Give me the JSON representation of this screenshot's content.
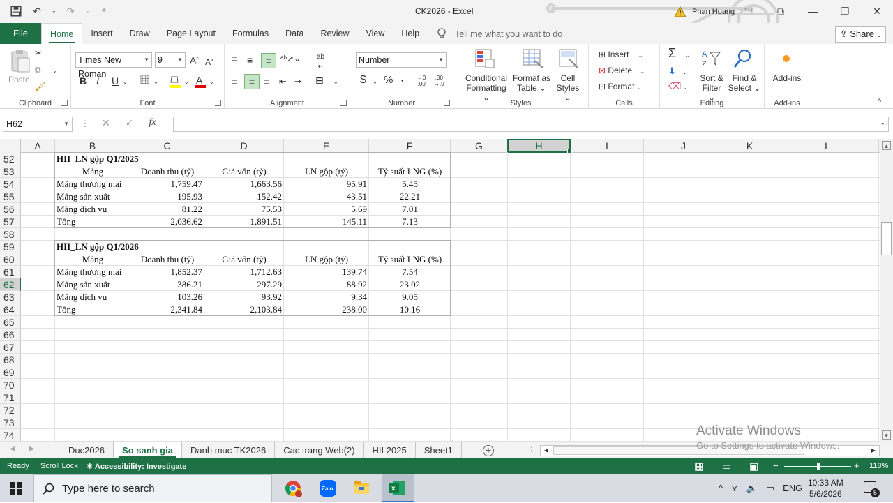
{
  "window": {
    "title": "CK2026  -  Excel",
    "user_name": "Phan Hoang",
    "user_initials": "PH"
  },
  "menu": {
    "file": "File",
    "tabs": [
      "Home",
      "Insert",
      "Draw",
      "Page Layout",
      "Formulas",
      "Data",
      "Review",
      "View",
      "Help"
    ],
    "active_tab": "Home",
    "tell_me": "Tell me what you want to do",
    "share": "Share"
  },
  "ribbon": {
    "clipboard": {
      "paste": "Paste",
      "label": "Clipboard"
    },
    "font": {
      "family": "Times New Roman",
      "size": "9",
      "label": "Font",
      "bold": "B",
      "italic": "I",
      "underline": "U"
    },
    "alignment": {
      "label": "Alignment"
    },
    "number": {
      "format": "Number",
      "label": "Number",
      "currency": "$",
      "percent": "%",
      "comma": ","
    },
    "styles": {
      "conditional": "Conditional",
      "conditional2": "Formatting",
      "format_as": "Format as",
      "format_as2": "Table",
      "cell": "Cell",
      "cell2": "Styles",
      "label": "Styles"
    },
    "cells": {
      "insert": "Insert",
      "delete": "Delete",
      "format": "Format",
      "label": "Cells"
    },
    "editing": {
      "sort": "Sort &",
      "sort2": "Filter",
      "find": "Find &",
      "find2": "Select",
      "label": "Editing"
    },
    "addins": {
      "addins": "Add-ins",
      "label": "Add-ins"
    }
  },
  "formula_bar": {
    "name_box": "H62",
    "fx": "fx",
    "value": ""
  },
  "columns": [
    "A",
    "B",
    "C",
    "D",
    "E",
    "F",
    "G",
    "H",
    "I",
    "J",
    "K",
    "L"
  ],
  "selected_column": "H",
  "rows": [
    "52",
    "53",
    "54",
    "55",
    "56",
    "57",
    "58",
    "59",
    "60",
    "61",
    "62",
    "63",
    "64",
    "65",
    "66",
    "67",
    "68",
    "69",
    "70",
    "71",
    "72",
    "73",
    "74"
  ],
  "selected_row": "62",
  "table1": {
    "title": "HII_LN gộp Q1/2025",
    "headers": [
      "Mảng",
      "Doanh thu (tỷ)",
      "Giá vốn (tỷ)",
      "LN gộp (tỷ)",
      "Tỷ suất LNG (%)"
    ],
    "rows": [
      [
        "Mảng thương mại",
        "1,759.47",
        "1,663.56",
        "95.91",
        "5.45"
      ],
      [
        "Mảng sản xuất",
        "195.93",
        "152.42",
        "43.51",
        "22.21"
      ],
      [
        "Mảng dịch vụ",
        "81.22",
        "75.53",
        "5.69",
        "7.01"
      ],
      [
        "Tổng",
        "2,036.62",
        "1,891.51",
        "145.11",
        "7.13"
      ]
    ]
  },
  "table2": {
    "title": "HII_LN gộp Q1/2026",
    "headers": [
      "Mảng",
      "Doanh thu (tỷ)",
      "Giá vốn (tỷ)",
      "LN gộp (tỷ)",
      "Tỷ suất LNG (%)"
    ],
    "rows": [
      [
        "Mảng thương mại",
        "1,852.37",
        "1,712.63",
        "139.74",
        "7.54"
      ],
      [
        "Mảng sản xuất",
        "386.21",
        "297.29",
        "88.92",
        "23.02"
      ],
      [
        "Mảng dịch vụ",
        "103.26",
        "93.92",
        "9.34",
        "9.05"
      ],
      [
        "Tổng",
        "2,341.84",
        "2,103.84",
        "238.00",
        "10.16"
      ]
    ]
  },
  "sheets": [
    "Duc2026",
    "So sanh gia",
    "Danh muc TK2026",
    "Cac trang Web(2)",
    "HII 2025",
    "Sheet1"
  ],
  "active_sheet": "So sanh gia",
  "watermark": {
    "line1": "Activate Windows",
    "line2": "Go to Settings to activate Windows."
  },
  "status": {
    "ready": "Ready",
    "scroll_lock": "Scroll Lock",
    "accessibility": "Accessibility: Investigate",
    "zoom": "118%"
  },
  "taskbar": {
    "search_placeholder": "Type here to search",
    "lang": "ENG",
    "time": "10:33 AM",
    "date": "5/6/2026",
    "notifications": "5"
  },
  "colors": {
    "excel_green": "#1e7145",
    "taskbar": "#d9dde3"
  }
}
